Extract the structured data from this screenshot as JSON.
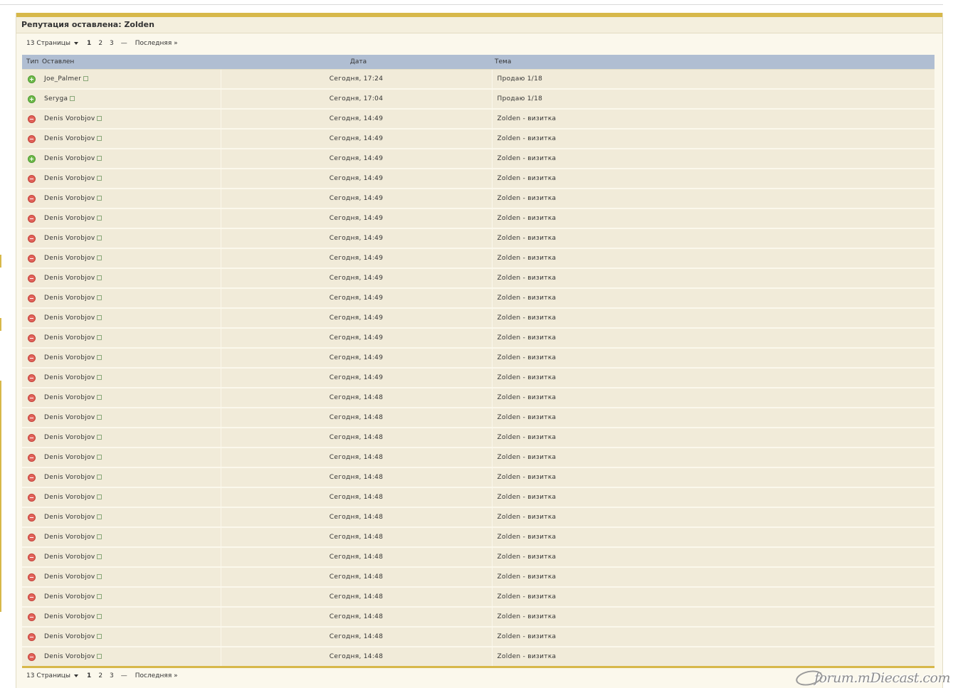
{
  "title": "Репутация оставлена: Zolden",
  "pagination": {
    "pages_label": "13 Страницы",
    "pages": [
      "1",
      "2",
      "3"
    ],
    "current": "1",
    "ellipsis": "—",
    "last_label": "Последняя »"
  },
  "columns": {
    "type": "Тип",
    "by": "Оставлен",
    "date": "Дата",
    "topic": "Тема"
  },
  "rows": [
    {
      "type": "positive",
      "by": "Joe_Palmer",
      "date": "Сегодня, 17:24",
      "topic": "Продаю 1/18"
    },
    {
      "type": "positive",
      "by": "Seryga",
      "date": "Сегодня, 17:04",
      "topic": "Продаю 1/18"
    },
    {
      "type": "negative",
      "by": "Denis Vorobjov",
      "date": "Сегодня, 14:49",
      "topic": "Zolden - визитка"
    },
    {
      "type": "negative",
      "by": "Denis Vorobjov",
      "date": "Сегодня, 14:49",
      "topic": "Zolden - визитка"
    },
    {
      "type": "positive",
      "by": "Denis Vorobjov",
      "date": "Сегодня, 14:49",
      "topic": "Zolden - визитка"
    },
    {
      "type": "negative",
      "by": "Denis Vorobjov",
      "date": "Сегодня, 14:49",
      "topic": "Zolden - визитка"
    },
    {
      "type": "negative",
      "by": "Denis Vorobjov",
      "date": "Сегодня, 14:49",
      "topic": "Zolden - визитка"
    },
    {
      "type": "negative",
      "by": "Denis Vorobjov",
      "date": "Сегодня, 14:49",
      "topic": "Zolden - визитка"
    },
    {
      "type": "negative",
      "by": "Denis Vorobjov",
      "date": "Сегодня, 14:49",
      "topic": "Zolden - визитка"
    },
    {
      "type": "negative",
      "by": "Denis Vorobjov",
      "date": "Сегодня, 14:49",
      "topic": "Zolden - визитка"
    },
    {
      "type": "negative",
      "by": "Denis Vorobjov",
      "date": "Сегодня, 14:49",
      "topic": "Zolden - визитка"
    },
    {
      "type": "negative",
      "by": "Denis Vorobjov",
      "date": "Сегодня, 14:49",
      "topic": "Zolden - визитка"
    },
    {
      "type": "negative",
      "by": "Denis Vorobjov",
      "date": "Сегодня, 14:49",
      "topic": "Zolden - визитка"
    },
    {
      "type": "negative",
      "by": "Denis Vorobjov",
      "date": "Сегодня, 14:49",
      "topic": "Zolden - визитка"
    },
    {
      "type": "negative",
      "by": "Denis Vorobjov",
      "date": "Сегодня, 14:49",
      "topic": "Zolden - визитка"
    },
    {
      "type": "negative",
      "by": "Denis Vorobjov",
      "date": "Сегодня, 14:49",
      "topic": "Zolden - визитка"
    },
    {
      "type": "negative",
      "by": "Denis Vorobjov",
      "date": "Сегодня, 14:48",
      "topic": "Zolden - визитка"
    },
    {
      "type": "negative",
      "by": "Denis Vorobjov",
      "date": "Сегодня, 14:48",
      "topic": "Zolden - визитка"
    },
    {
      "type": "negative",
      "by": "Denis Vorobjov",
      "date": "Сегодня, 14:48",
      "topic": "Zolden - визитка"
    },
    {
      "type": "negative",
      "by": "Denis Vorobjov",
      "date": "Сегодня, 14:48",
      "topic": "Zolden - визитка"
    },
    {
      "type": "negative",
      "by": "Denis Vorobjov",
      "date": "Сегодня, 14:48",
      "topic": "Zolden - визитка"
    },
    {
      "type": "negative",
      "by": "Denis Vorobjov",
      "date": "Сегодня, 14:48",
      "topic": "Zolden - визитка"
    },
    {
      "type": "negative",
      "by": "Denis Vorobjov",
      "date": "Сегодня, 14:48",
      "topic": "Zolden - визитка"
    },
    {
      "type": "negative",
      "by": "Denis Vorobjov",
      "date": "Сегодня, 14:48",
      "topic": "Zolden - визитка"
    },
    {
      "type": "negative",
      "by": "Denis Vorobjov",
      "date": "Сегодня, 14:48",
      "topic": "Zolden - визитка"
    },
    {
      "type": "negative",
      "by": "Denis Vorobjov",
      "date": "Сегодня, 14:48",
      "topic": "Zolden - визитка"
    },
    {
      "type": "negative",
      "by": "Denis Vorobjov",
      "date": "Сегодня, 14:48",
      "topic": "Zolden - визитка"
    },
    {
      "type": "negative",
      "by": "Denis Vorobjov",
      "date": "Сегодня, 14:48",
      "topic": "Zolden - визитка"
    },
    {
      "type": "negative",
      "by": "Denis Vorobjov",
      "date": "Сегодня, 14:48",
      "topic": "Zolden - визитка"
    },
    {
      "type": "negative",
      "by": "Denis Vorobjov",
      "date": "Сегодня, 14:48",
      "topic": "Zolden - визитка"
    }
  ],
  "icons": {
    "positive": "plus-circle-icon",
    "negative": "minus-circle-icon",
    "profile_link": "external-link-icon"
  },
  "colors": {
    "accent_gold": "#d7b84a",
    "header_blue": "#b0bed2",
    "row_bg": "#f1ebd9",
    "positive": "#6fba4c",
    "negative": "#e2635b"
  },
  "watermark": "forum.mDiecast.com"
}
